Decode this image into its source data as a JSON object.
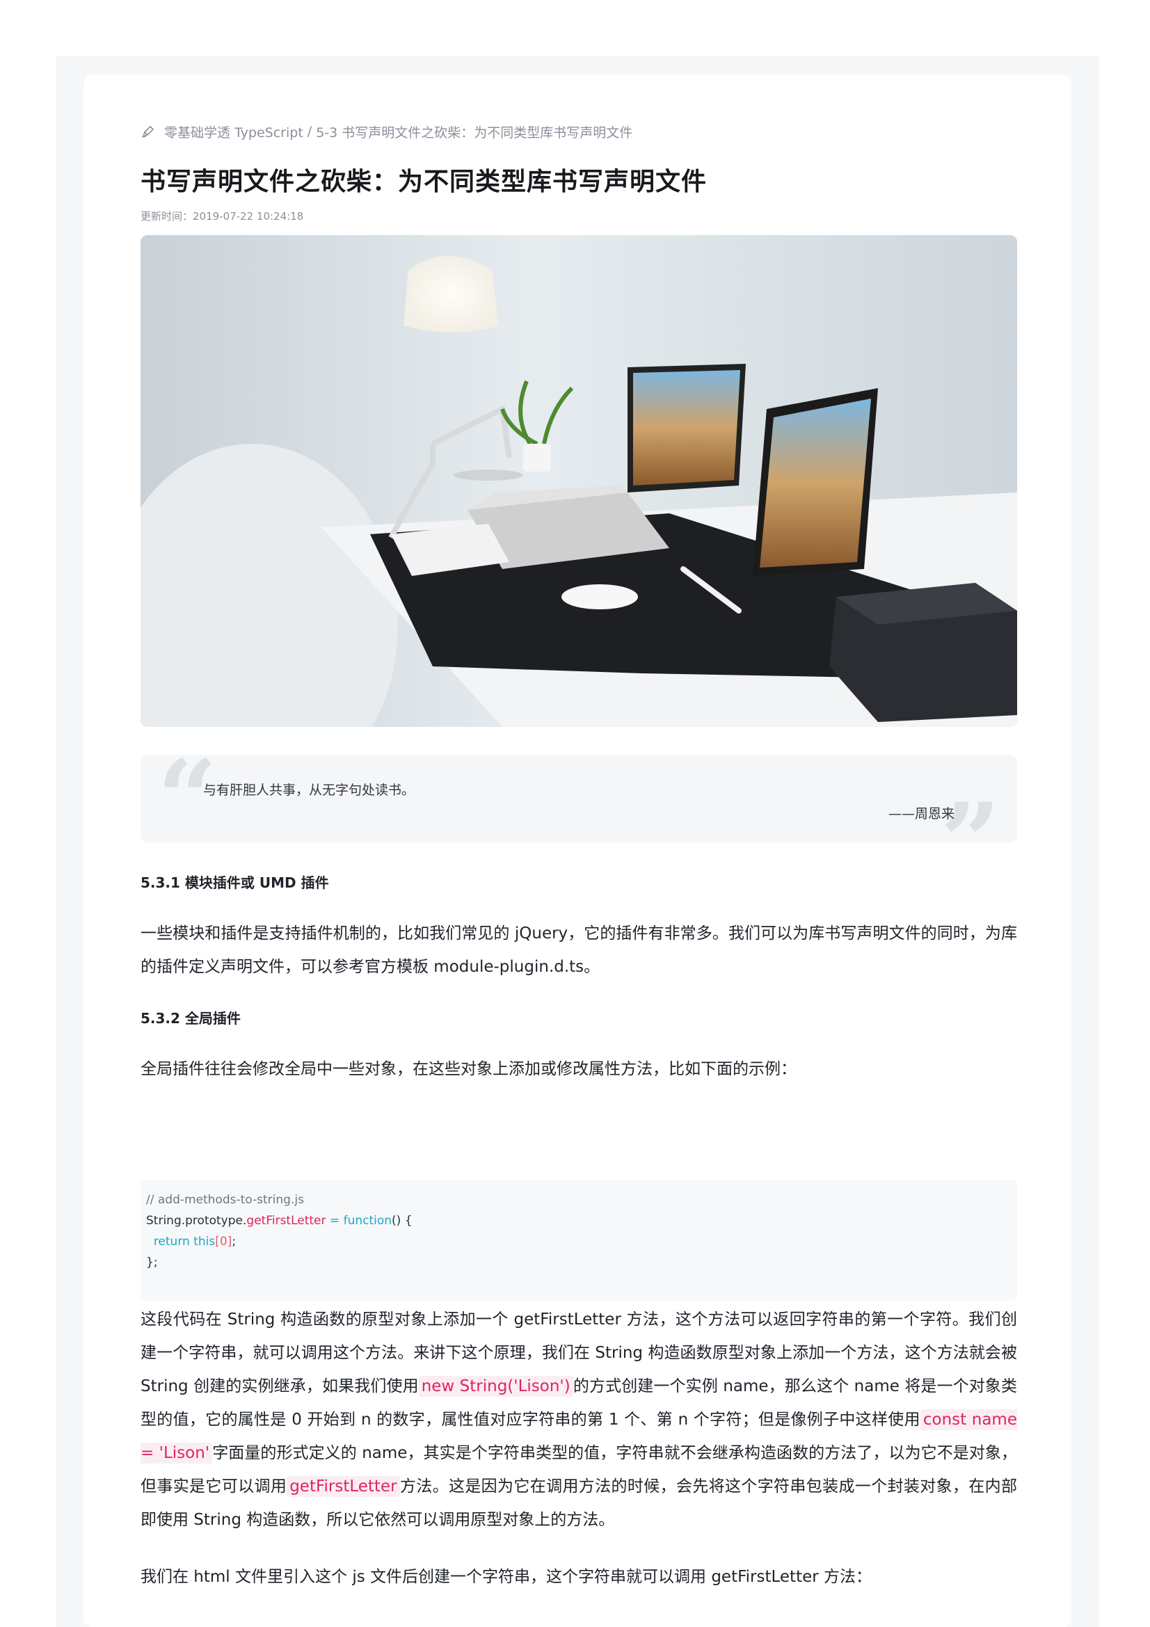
{
  "breadcrumb": {
    "course": "零基础学透 TypeScript",
    "separator": "/",
    "chapter": "5-3 书写声明文件之砍柴：为不同类型库书写声明文件"
  },
  "article": {
    "title": "书写声明文件之砍柴：为不同类型库书写声明文件",
    "update_time": "更新时间：2019-07-22 10:24:18"
  },
  "quote": {
    "text": "与有肝胆人共事，从无字句处读书。",
    "author": "——周恩来"
  },
  "sections": {
    "s1_heading": "5.3.1 模块插件或 UMD 插件",
    "s1_para": "一些模块和插件是支持插件机制的，比如我们常见的 jQuery，它的插件有非常多。我们可以为库书写声明文件的同时，为库的插件定义声明文件，可以参考官方模板 module-plugin.d.ts。",
    "s2_heading": "5.3.2 全局插件",
    "s2_para": "全局插件往往会修改全局中一些对象，在这些对象上添加或修改属性方法，比如下面的示例："
  },
  "code": {
    "comment": "// add-methods-to-string.js",
    "l2_obj": "String.prototype.",
    "l2_prop": "getFirstLetter",
    "l2_op": " = ",
    "l2_fn": "function",
    "l2_rest": "() {",
    "l3_indent": "  ",
    "l3_kw": "return this",
    "l3_idx": "[0]",
    "l3_end": ";",
    "l4": "};"
  },
  "explain": {
    "p_a": "这段代码在 String 构造函数的原型对象上添加一个 getFirstLetter 方法，这个方法可以返回字符串的第一个字符。我们创建一个字符串，就可以调用这个方法。来讲下这个原理，我们在 String 构造函数原型对象上添加一个方法，这个方法就会被 String 创建的实例继承，如果我们使用",
    "code_a": "new String('Lison')",
    "p_b": "的方式创建一个实例 name，那么这个 name 将是一个对象类型的值，它的属性是 0 开始到 n 的数字，属性值对应字符串的第 1 个、第 n 个字符；但是像例子中这样使用",
    "code_b": "const name = 'Lison'",
    "p_c": "字面量的形式定义的 name，其实是个字符串类型的值，字符串就不会继承构造函数的方法了，以为它不是对象，但事实是它可以调用",
    "code_c": "getFirstLetter",
    "p_d": "方法。这是因为它在调用方法的时候，会先将这个字符串包装成一个封装对象，在内部即使用 String 构造函数，所以它依然可以调用原型对象上的方法。",
    "last": "我们在 html 文件里引入这个 js 文件后创建一个字符串，这个字符串就可以调用 getFirstLetter 方法："
  },
  "colors": {
    "inline_code": "#e0245e",
    "code_keyword": "#1aa8c4",
    "muted": "#8a8f99"
  }
}
